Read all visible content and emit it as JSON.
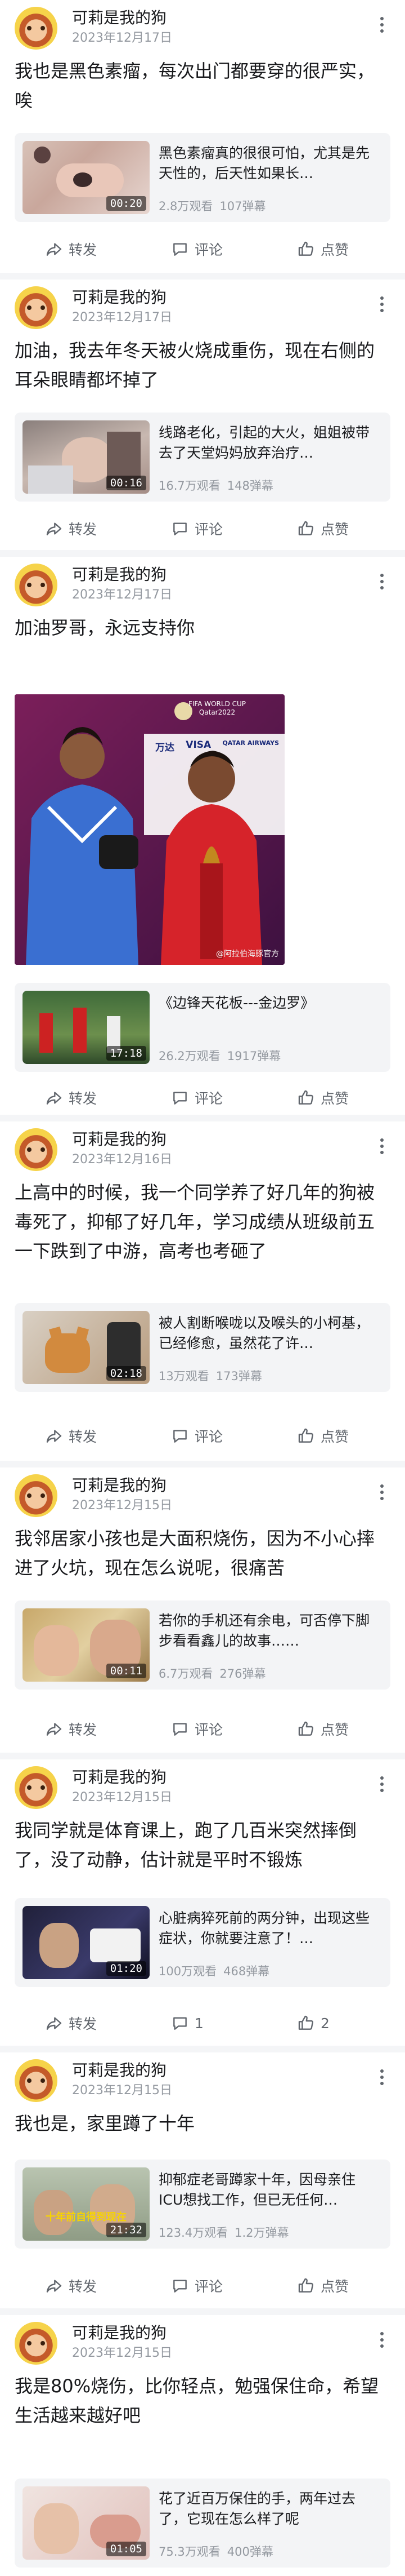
{
  "actions": {
    "forward": "转发",
    "comment": "评论",
    "like": "点赞"
  },
  "posts": [
    {
      "user": "可莉是我的狗",
      "date": "2023年12月17日",
      "text": "我也是黑色素瘤，每次出门都要穿的很严实，唉",
      "video": {
        "title": "黑色素瘤真的很很可怕，尤其是先天性的，后天性如果长…",
        "duration": "00:20",
        "views": "2.8万观看",
        "danmaku": "107弹幕"
      }
    },
    {
      "user": "可莉是我的狗",
      "date": "2023年12月17日",
      "text": "加油，我去年冬天被火烧成重伤，现在右侧的耳朵眼睛都坏掉了",
      "video": {
        "title": "线路老化，引起的大火，姐姐被带去了天堂妈妈放弃治疗…",
        "duration": "00:16",
        "views": "16.7万观看",
        "danmaku": "148弹幕"
      }
    },
    {
      "user": "可莉是我的狗",
      "date": "2023年12月17日",
      "text": "加油罗哥，永远支持你",
      "photo": {
        "badge_line1": "FIFA WORLD CUP",
        "badge_line2": "Qatar2022",
        "sponsors": [
          "万达",
          "VISA",
          "QATAR AIRWAYS"
        ],
        "watermark": "@阿拉伯海豚官方"
      },
      "video": {
        "title": "《边锋天花板---金边罗》",
        "duration": "17:18",
        "views": "26.2万观看",
        "danmaku": "1917弹幕"
      }
    },
    {
      "user": "可莉是我的狗",
      "date": "2023年12月16日",
      "text": "上高中的时候，我一个同学养了好几年的狗被毒死了，抑郁了好几年，学习成绩从班级前五一下跌到了中游，高考也考砸了",
      "video": {
        "title": "被人割断喉咙以及喉头的小柯基，已经修愈，虽然花了许…",
        "duration": "02:18",
        "views": "13万观看",
        "danmaku": "173弹幕"
      }
    },
    {
      "user": "可莉是我的狗",
      "date": "2023年12月15日",
      "text": "我邻居家小孩也是大面积烧伤，因为不小心摔进了火坑，现在怎么说呢，很痛苦",
      "video": {
        "title": "若你的手机还有余电，可否停下脚步看看鑫儿的故事……",
        "duration": "00:11",
        "views": "6.7万观看",
        "danmaku": "276弹幕"
      }
    },
    {
      "user": "可莉是我的狗",
      "date": "2023年12月15日",
      "text": "我同学就是体育课上，跑了几百米突然摔倒了，没了动静，估计就是平时不锻炼",
      "video": {
        "title": "心脏病猝死前的两分钟，出现这些症状，你就要注意了！…",
        "duration": "01:20",
        "views": "100万观看",
        "danmaku": "468弹幕"
      },
      "counts": {
        "comment": "1",
        "like": "2"
      }
    },
    {
      "user": "可莉是我的狗",
      "date": "2023年12月15日",
      "text": "我也是，家里蹲了十年",
      "video": {
        "title": "抑郁症老哥蹲家十年，因母亲住ICU想找工作，但已无任何…",
        "duration": "21:32",
        "views": "123.4万观看",
        "danmaku": "1.2万弹幕",
        "thumb_caption": "十年前自得到现在"
      }
    },
    {
      "user": "可莉是我的狗",
      "date": "2023年12月15日",
      "text": "我是80%烧伤，比你轻点，勉强保住命，希望生活越来越好吧",
      "video": {
        "title": "花了近百万保住的手，两年过去了，它现在怎么样了呢",
        "duration": "01:05",
        "views": "75.3万观看",
        "danmaku": "400弹幕"
      }
    }
  ]
}
